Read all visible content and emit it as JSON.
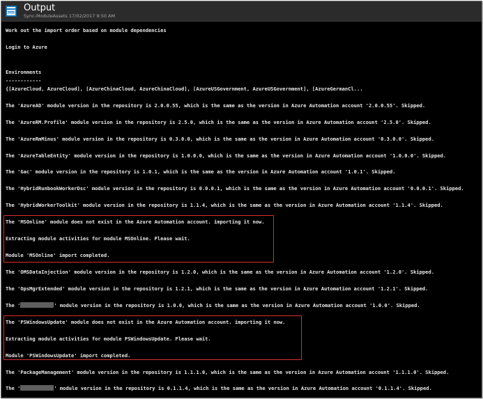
{
  "header": {
    "title": "Output",
    "subtitle": "Sync-ModuleAssets 17/02/2017 9:50 AM",
    "icon": "output-blade-icon"
  },
  "colors": {
    "console_bg": "#000000",
    "console_text": "#e8e8e8",
    "highlight": "#d9302c",
    "header_bg": "#2b2b2b"
  },
  "lines": {
    "l1": "Work out the import order based on module dependencies",
    "l2": "Login to Azure",
    "l3": "Environments",
    "l4": "------------",
    "l5": "{[AzureCloud, AzureCloud], [AzureChinaCloud, AzureChinaCloud], [AzureUSGovernment, AzureUSGovernment], [AzureGermanCl...",
    "l6": "The 'AzureAD' module version in the repository is 2.0.0.55, which is the same as the version in Azure Automation account '2.0.0.55'. Skipped.",
    "l7": "The 'AzureRM.Profile' module version in the repository is 2.5.0, which is the same as the version in Azure Automation account '2.5.0'. Skipped.",
    "l8": "The 'AzureRmMinus' module version in the repository is 0.3.0.0, which is the same as the version in Azure Automation account '0.3.0.0'. Skipped.",
    "l9": "The 'AzureTableEntity' module version in the repository is 1.0.0.0, which is the same as the version in Azure Automation account '1.0.0.0'. Skipped.",
    "l10": "The 'Gac' module version in the repository is 1.0.1, which is the same as the version in Azure Automation account '1.0.1'. Skipped.",
    "l11": "The 'HybridRunbookWorkerDsc' module version in the repository is 0.0.0.1, which is the same as the version in Azure Automation account '0.0.0.1'. Skipped.",
    "l12": "The 'HybridWorkerToolkit' module version in the repository is 1.1.4, which is the same as the version in Azure Automation account '1.1.4'. Skipped.",
    "l13": "The 'MSOnline' module does not exist in the Azure Automation account. importing it now.",
    "l14": "Extracting module activities for module MSOnline. Please wait.",
    "l15": "Module 'MSOnline' import completed.",
    "l16": "The 'OMSDataInjection' module version in the repository is 1.2.0, which is the same as the version in Azure Automation account '1.2.0'. Skipped.",
    "l17": "The 'OpsMgrExtended' module version in the repository is 1.2.1, which is the same as the version in Azure Automation account '1.2.1'. Skipped.",
    "l18_prefix": "The '",
    "l18_suffix": "' module version in the repository is 1.0.0, which is the same as the version in Azure Automation account '1.0.0'. Skipped.",
    "l19": "The 'PSWindowsUpdate' module does not exist in the Azure Automation account. importing it now.",
    "l20": "Extracting module activities for module PSWindowsUpdate. Please wait.",
    "l21": "Module 'PSWindowsUpdate' import completed.",
    "l22": "The 'PackageManagement' module version in the repository is 1.1.1.0, which is the same as the version in Azure Automation account '1.1.1.0'. Skipped.",
    "l23_prefix": "The '",
    "l23_suffix": "' module version in the repository is 0.1.1.4, which is the same as the version in Azure Automation account '0.1.1.4'. Skipped."
  }
}
